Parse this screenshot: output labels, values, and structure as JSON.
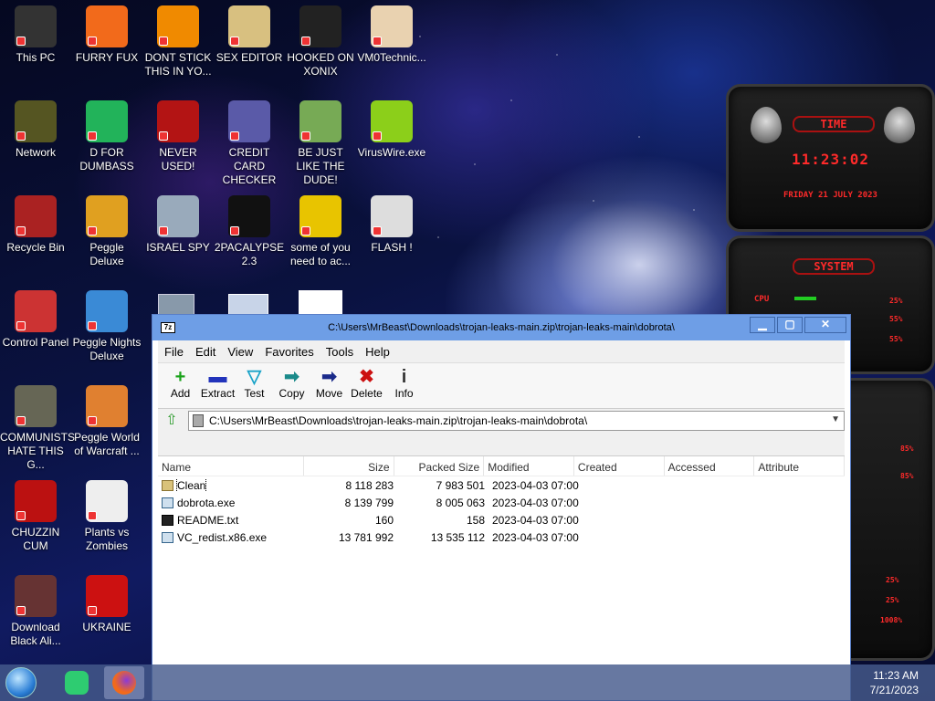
{
  "desktop": {
    "icons": [
      {
        "label": "This PC",
        "icon": "pc-icon"
      },
      {
        "label": "FURRY FUX",
        "icon": "firefox-icon"
      },
      {
        "label": "DONT STICK THIS IN YO...",
        "icon": "vlc-icon"
      },
      {
        "label": "SEX EDITOR",
        "icon": "hex-editor-icon"
      },
      {
        "label": "HOOKED ON XONIX",
        "icon": "xonix-icon"
      },
      {
        "label": "VM0Technic...",
        "icon": "doctor-icon"
      },
      {
        "label": "Network",
        "icon": "network-icon"
      },
      {
        "label": "D FOR DUMBASS",
        "icon": "chat-icon"
      },
      {
        "label": "NEVER USED!",
        "icon": "devcpp-icon"
      },
      {
        "label": "CREDIT CARD CHECKER",
        "icon": "credit-card-icon"
      },
      {
        "label": "BE JUST LIKE THE DUDE!",
        "icon": "santa-icon"
      },
      {
        "label": "VirusWire.exe",
        "icon": "lime-icon"
      },
      {
        "label": "Recycle Bin",
        "icon": "recycle-bin-icon"
      },
      {
        "label": "Peggle Deluxe",
        "icon": "peggle-icon"
      },
      {
        "label": "ISRAEL SPY",
        "icon": "spy-icon"
      },
      {
        "label": "2PACALYPSE 2.3",
        "icon": "terminal-icon"
      },
      {
        "label": "some of you need to ac...",
        "icon": "dog-icon"
      },
      {
        "label": "FLASH !",
        "icon": "flash-icon"
      },
      {
        "label": "Control Panel",
        "icon": "control-panel-icon"
      },
      {
        "label": "Peggle Nights Deluxe",
        "icon": "peggle-nights-icon"
      },
      {
        "label": "COMMUNISTS HATE THIS G...",
        "icon": "money-bag-icon"
      },
      {
        "label": "Peggle World of Warcraft ...",
        "icon": "peggle-wow-icon"
      },
      {
        "label": "CHUZZIN CUM",
        "icon": "chuzzle-icon"
      },
      {
        "label": "Plants vs Zombies",
        "icon": "plants-icon"
      },
      {
        "label": "Download Black Ali...",
        "icon": "alien-icon"
      },
      {
        "label": "UKRAINE",
        "icon": "radiation-icon"
      }
    ]
  },
  "gadget": {
    "time_title": "TIME",
    "time": "11:23:02",
    "date": "FRIDAY 21 JULY 2023",
    "system_title": "SYSTEM",
    "cpu_label": "CPU",
    "cpu_value": "25%",
    "values": [
      "55%",
      "55%",
      "85%",
      "85%",
      "25%",
      "25%",
      "1008%"
    ]
  },
  "window": {
    "title": "C:\\Users\\MrBeast\\Downloads\\trojan-leaks-main.zip\\trojan-leaks-main\\dobrota\\",
    "app_icon": "7z",
    "menu": [
      "File",
      "Edit",
      "View",
      "Favorites",
      "Tools",
      "Help"
    ],
    "toolbar": [
      {
        "label": "Add",
        "icon": "add-icon",
        "glyph": "+",
        "color": "#1aa31a"
      },
      {
        "label": "Extract",
        "icon": "extract-icon",
        "glyph": "▬",
        "color": "#2233bb"
      },
      {
        "label": "Test",
        "icon": "test-icon",
        "glyph": "▽",
        "color": "#1aa3c8"
      },
      {
        "label": "Copy",
        "icon": "copy-icon",
        "glyph": "➡",
        "color": "#1a8a8a"
      },
      {
        "label": "Move",
        "icon": "move-icon",
        "glyph": "➡",
        "color": "#1a2a8a"
      },
      {
        "label": "Delete",
        "icon": "delete-icon",
        "glyph": "✖",
        "color": "#cc1111"
      },
      {
        "label": "Info",
        "icon": "info-icon",
        "glyph": "i",
        "color": "#333"
      }
    ],
    "address": "C:\\Users\\MrBeast\\Downloads\\trojan-leaks-main.zip\\trojan-leaks-main\\dobrota\\",
    "columns": [
      "Name",
      "Size",
      "Packed Size",
      "Modified",
      "Created",
      "Accessed",
      "Attribute"
    ],
    "rows": [
      {
        "name": "Clean",
        "type": "folder",
        "size": "8 118 283",
        "packed": "7 983 501",
        "modified": "2023-04-03 07:00"
      },
      {
        "name": "dobrota.exe",
        "type": "exe",
        "size": "8 139 799",
        "packed": "8 005 063",
        "modified": "2023-04-03 07:00"
      },
      {
        "name": "README.txt",
        "type": "txt",
        "size": "160",
        "packed": "158",
        "modified": "2023-04-03 07:00"
      },
      {
        "name": "VC_redist.x86.exe",
        "type": "exe",
        "size": "13 781 992",
        "packed": "13 535 112",
        "modified": "2023-04-03 07:00"
      }
    ]
  },
  "taskbar": {
    "time": "11:23 AM",
    "date": "7/21/2023"
  }
}
